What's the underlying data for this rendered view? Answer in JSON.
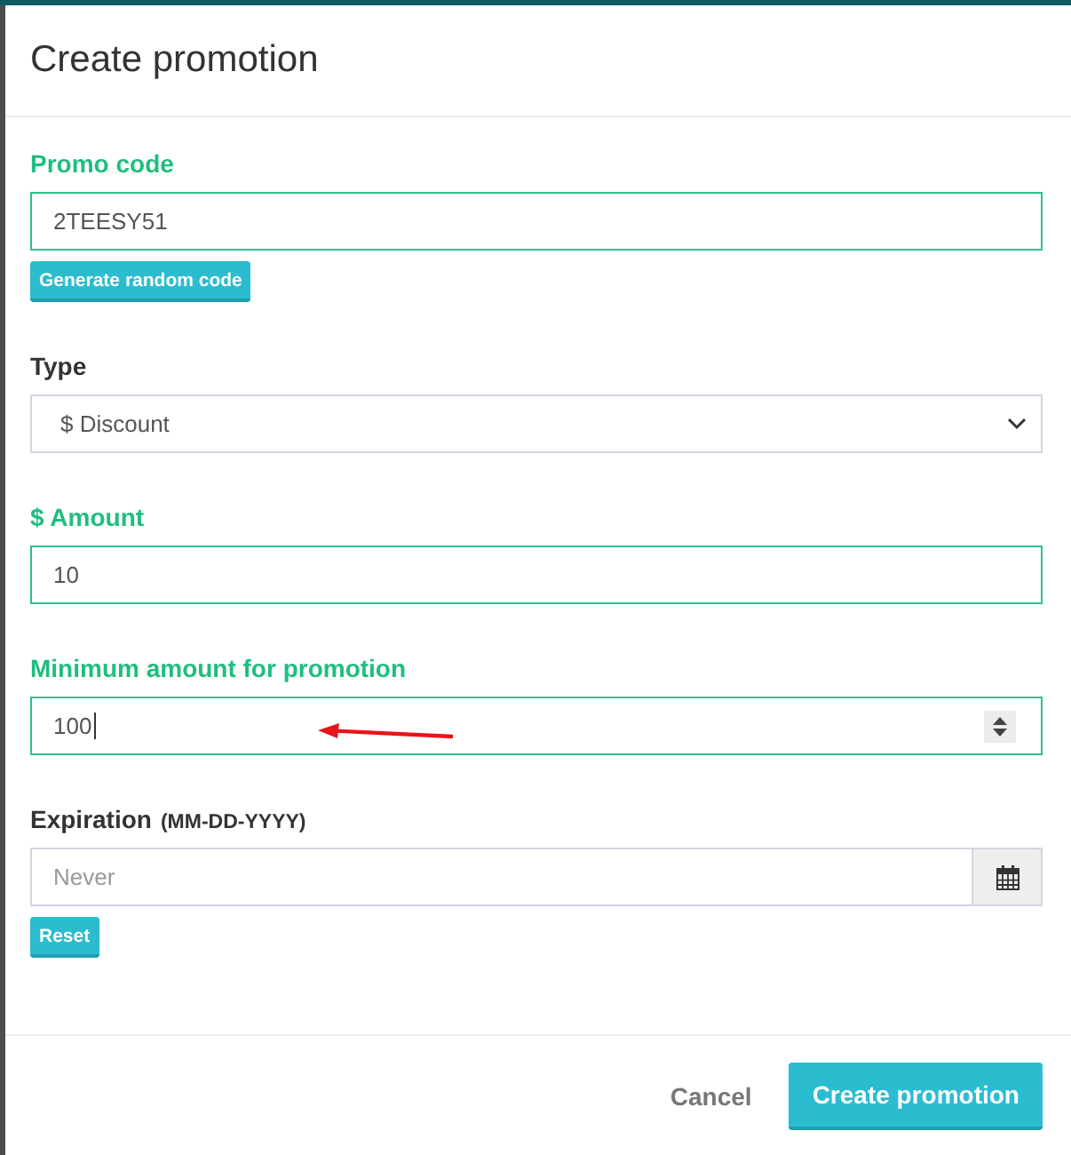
{
  "dialog": {
    "title": "Create promotion"
  },
  "fields": [
    {
      "kind": "text",
      "label": "Promo code",
      "value": "2TEESY51",
      "validated": true,
      "focused": false,
      "annotated": false,
      "action": "Generate random code"
    },
    {
      "kind": "select",
      "label": "Type",
      "value": "$ Discount",
      "validated": false,
      "focused": false,
      "annotated": false
    },
    {
      "kind": "text",
      "label": "$ Amount",
      "value": "10",
      "validated": true,
      "focused": false,
      "annotated": false
    },
    {
      "kind": "number",
      "label": "Minimum amount for promotion",
      "value": "100",
      "validated": true,
      "focused": true,
      "annotated": true
    },
    {
      "kind": "date",
      "label": "Expiration",
      "hint": "(MM-DD-YYYY)",
      "placeholder": "Never",
      "validated": false,
      "focused": false,
      "annotated": false,
      "action": "Reset"
    }
  ],
  "footer": {
    "buttons": [
      {
        "kind": "link",
        "label": "Cancel"
      },
      {
        "kind": "primary",
        "label": "Create promotion"
      }
    ]
  }
}
